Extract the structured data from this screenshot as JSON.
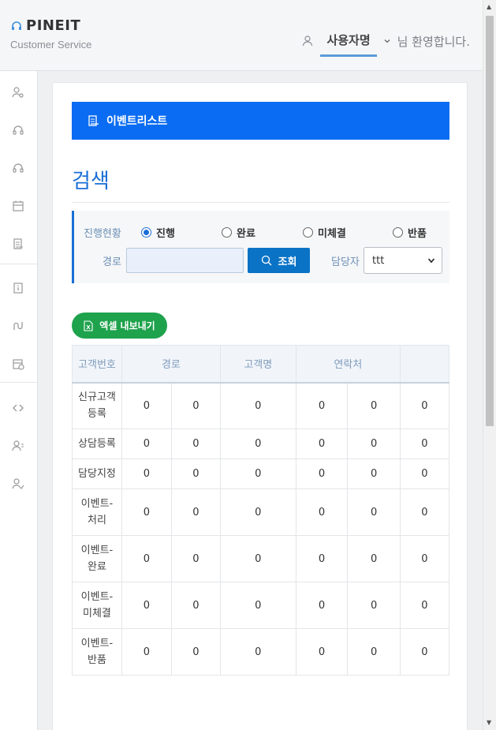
{
  "header": {
    "brand_title": "PINEIT",
    "brand_subtitle": "Customer Service",
    "user_name": "사용자명",
    "welcome_text": "님 환영합니다."
  },
  "sidebar": {
    "icons": [
      "user-search-icon",
      "headset-icon",
      "headset-icon",
      "calendar-icon",
      "document-icon",
      "info-document-icon",
      "route-icon",
      "calendar-clock-icon",
      "code-icon",
      "user-list-icon",
      "user-check-icon"
    ]
  },
  "banner": {
    "title": "이벤트리스트"
  },
  "search": {
    "title": "검색",
    "status_label": "진행현황",
    "status_options": [
      {
        "label": "진행",
        "checked": true
      },
      {
        "label": "완료",
        "checked": false
      },
      {
        "label": "미체결",
        "checked": false
      },
      {
        "label": "반품",
        "checked": false
      }
    ],
    "route_label": "경로",
    "route_value": "",
    "search_button": "조회",
    "manager_label": "담당자",
    "manager_selected": "ttt"
  },
  "excel_button": "엑셀 내보내기",
  "table": {
    "columns": [
      "고객번호",
      "경로",
      "고객명",
      "연락처",
      ""
    ],
    "rows": [
      {
        "label": "신규고객\n등록",
        "values": [
          "0",
          "0",
          "0",
          "0",
          "0",
          "0"
        ]
      },
      {
        "label": "상담등록",
        "values": [
          "0",
          "0",
          "0",
          "0",
          "0",
          "0"
        ]
      },
      {
        "label": "담당지정",
        "values": [
          "0",
          "0",
          "0",
          "0",
          "0",
          "0"
        ]
      },
      {
        "label": "이벤트-\n처리",
        "values": [
          "0",
          "0",
          "0",
          "0",
          "0",
          "0"
        ]
      },
      {
        "label": "이벤트-\n완료",
        "values": [
          "0",
          "0",
          "0",
          "0",
          "0",
          "0"
        ]
      },
      {
        "label": "이벤트-\n미체결",
        "values": [
          "0",
          "0",
          "0",
          "0",
          "0",
          "0"
        ]
      },
      {
        "label": "이벤트-\n반품",
        "values": [
          "0",
          "0",
          "0",
          "0",
          "0",
          "0"
        ]
      }
    ]
  },
  "colors": {
    "primary": "#0a6cf2",
    "title_blue": "#1a6fd6",
    "search_button": "#0a73c6",
    "excel_green": "#1ea24c"
  }
}
